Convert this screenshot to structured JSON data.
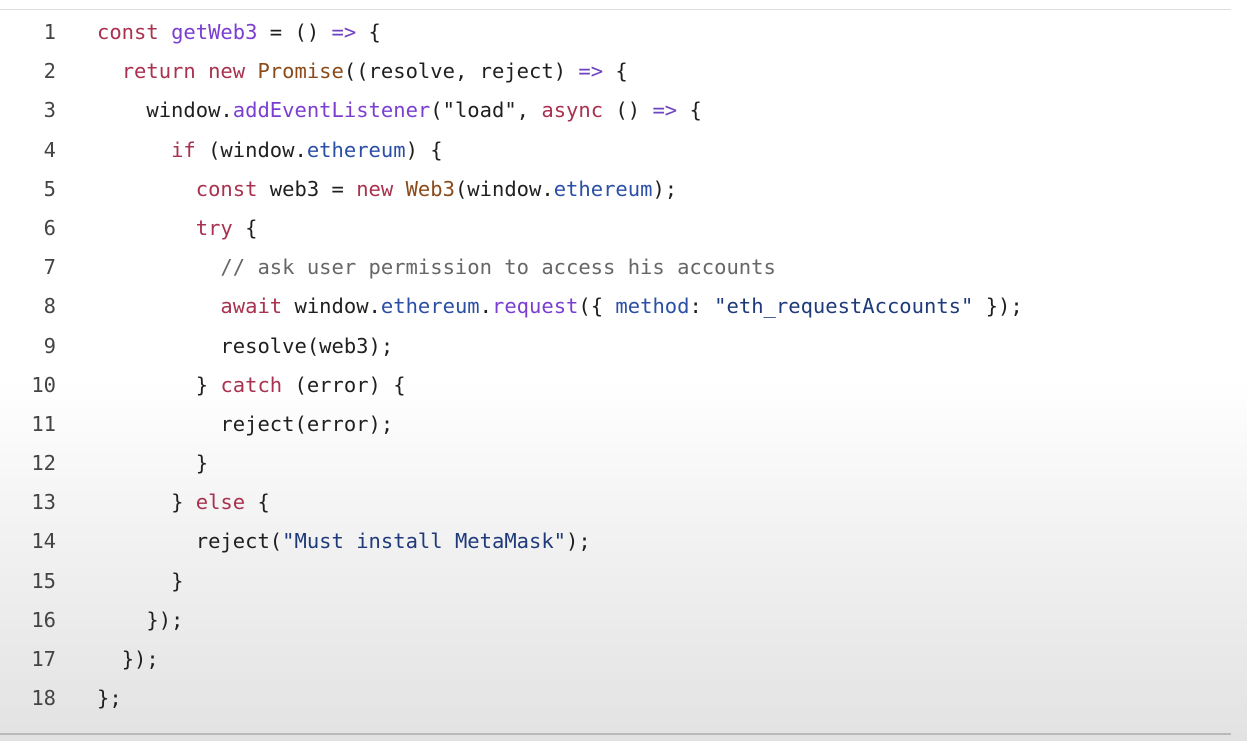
{
  "lines": [
    {
      "n": "1",
      "indent": "",
      "tokens": [
        {
          "t": "const",
          "c": "kw"
        },
        {
          "t": " ",
          "c": "pl"
        },
        {
          "t": "getWeb3",
          "c": "fn"
        },
        {
          "t": " = () ",
          "c": "pl"
        },
        {
          "t": "=>",
          "c": "op"
        },
        {
          "t": " {",
          "c": "pl"
        }
      ]
    },
    {
      "n": "2",
      "indent": "  ",
      "tokens": [
        {
          "t": "return",
          "c": "kw"
        },
        {
          "t": " ",
          "c": "pl"
        },
        {
          "t": "new",
          "c": "kw"
        },
        {
          "t": " ",
          "c": "pl"
        },
        {
          "t": "Promise",
          "c": "cls"
        },
        {
          "t": "((resolve, reject) ",
          "c": "pl"
        },
        {
          "t": "=>",
          "c": "op"
        },
        {
          "t": " {",
          "c": "pl"
        }
      ]
    },
    {
      "n": "3",
      "indent": "    ",
      "tokens": [
        {
          "t": "window.",
          "c": "pl"
        },
        {
          "t": "addEventListener",
          "c": "fn"
        },
        {
          "t": "(\"load\", ",
          "c": "pl"
        },
        {
          "t": "async",
          "c": "kw"
        },
        {
          "t": " () ",
          "c": "pl"
        },
        {
          "t": "=>",
          "c": "op"
        },
        {
          "t": " {",
          "c": "pl"
        }
      ]
    },
    {
      "n": "4",
      "indent": "      ",
      "tokens": [
        {
          "t": "if",
          "c": "kw"
        },
        {
          "t": " (window.",
          "c": "pl"
        },
        {
          "t": "ethereum",
          "c": "prop"
        },
        {
          "t": ") {",
          "c": "pl"
        }
      ]
    },
    {
      "n": "5",
      "indent": "        ",
      "tokens": [
        {
          "t": "const",
          "c": "kw"
        },
        {
          "t": " web3 = ",
          "c": "pl"
        },
        {
          "t": "new",
          "c": "kw"
        },
        {
          "t": " ",
          "c": "pl"
        },
        {
          "t": "Web3",
          "c": "cls"
        },
        {
          "t": "(window.",
          "c": "pl"
        },
        {
          "t": "ethereum",
          "c": "prop"
        },
        {
          "t": ");",
          "c": "pl"
        }
      ]
    },
    {
      "n": "6",
      "indent": "        ",
      "tokens": [
        {
          "t": "try",
          "c": "kw"
        },
        {
          "t": " {",
          "c": "pl"
        }
      ]
    },
    {
      "n": "7",
      "indent": "          ",
      "tokens": [
        {
          "t": "// ask user permission to access his accounts",
          "c": "cm"
        }
      ]
    },
    {
      "n": "8",
      "indent": "          ",
      "tokens": [
        {
          "t": "await",
          "c": "kw"
        },
        {
          "t": " window.",
          "c": "pl"
        },
        {
          "t": "ethereum",
          "c": "prop"
        },
        {
          "t": ".",
          "c": "pl"
        },
        {
          "t": "request",
          "c": "fn"
        },
        {
          "t": "({ ",
          "c": "pl"
        },
        {
          "t": "method",
          "c": "prop"
        },
        {
          "t": ": ",
          "c": "pl"
        },
        {
          "t": "\"eth_requestAccounts\"",
          "c": "str"
        },
        {
          "t": " });",
          "c": "pl"
        }
      ]
    },
    {
      "n": "9",
      "indent": "          ",
      "tokens": [
        {
          "t": "resolve(web3);",
          "c": "pl"
        }
      ]
    },
    {
      "n": "10",
      "indent": "        ",
      "tokens": [
        {
          "t": "} ",
          "c": "pl"
        },
        {
          "t": "catch",
          "c": "kw"
        },
        {
          "t": " (error) {",
          "c": "pl"
        }
      ]
    },
    {
      "n": "11",
      "indent": "          ",
      "tokens": [
        {
          "t": "reject(error);",
          "c": "pl"
        }
      ]
    },
    {
      "n": "12",
      "indent": "        ",
      "tokens": [
        {
          "t": "}",
          "c": "pl"
        }
      ]
    },
    {
      "n": "13",
      "indent": "      ",
      "tokens": [
        {
          "t": "} ",
          "c": "pl"
        },
        {
          "t": "else",
          "c": "kw"
        },
        {
          "t": " {",
          "c": "pl"
        }
      ]
    },
    {
      "n": "14",
      "indent": "        ",
      "tokens": [
        {
          "t": "reject(",
          "c": "pl"
        },
        {
          "t": "\"Must install MetaMask\"",
          "c": "str"
        },
        {
          "t": ");",
          "c": "pl"
        }
      ]
    },
    {
      "n": "15",
      "indent": "      ",
      "tokens": [
        {
          "t": "}",
          "c": "pl"
        }
      ]
    },
    {
      "n": "16",
      "indent": "    ",
      "tokens": [
        {
          "t": "});",
          "c": "pl"
        }
      ]
    },
    {
      "n": "17",
      "indent": "  ",
      "tokens": [
        {
          "t": "});",
          "c": "pl"
        }
      ]
    },
    {
      "n": "18",
      "indent": "",
      "tokens": [
        {
          "t": "};",
          "c": "pl"
        }
      ]
    }
  ]
}
